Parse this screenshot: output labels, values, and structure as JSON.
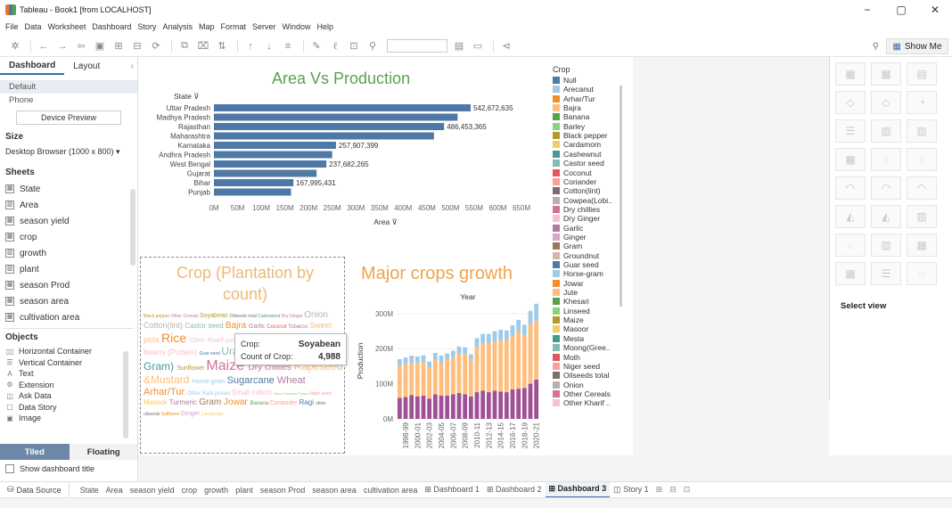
{
  "window": {
    "title": "Tableau - Book1 [from LOCALHOST]",
    "minimize": "−",
    "maximize": "▢",
    "close": "✕"
  },
  "menu": [
    "File",
    "Data",
    "Worksheet",
    "Dashboard",
    "Story",
    "Analysis",
    "Map",
    "Format",
    "Server",
    "Window",
    "Help"
  ],
  "toolbar": {
    "show_me": "Show Me"
  },
  "left_panel": {
    "tabs": [
      "Dashboard",
      "Layout"
    ],
    "devices": [
      "Default",
      "Phone"
    ],
    "device_preview": "Device Preview",
    "size_label": "Size",
    "size_value": "Desktop Browser (1000 x 800) ▾",
    "sheets_label": "Sheets",
    "sheets": [
      "State",
      "Area",
      "season yield",
      "crop",
      "growth",
      "plant",
      "season Prod",
      "season area",
      "cultivation area"
    ],
    "objects_label": "Objects",
    "objects": [
      "Horizontal Container",
      "Vertical Container",
      "Text",
      "Extension",
      "Ask Data",
      "Data Story",
      "Image"
    ],
    "tiled": "Tiled",
    "floating": "Floating",
    "show_title": "Show dashboard title"
  },
  "show_me": {
    "select_view": "Select view"
  },
  "sheet_tabs": {
    "data_source": "Data Source",
    "tabs": [
      "State",
      "Area",
      "season yield",
      "crop",
      "growth",
      "plant",
      "season Prod",
      "season area",
      "cultivation area",
      "Dashboard 1",
      "Dashboard 2",
      "Dashboard 3",
      "Story 1"
    ],
    "active": "Dashboard 3"
  },
  "dashboard": {
    "title1": "Area Vs Production",
    "title2": "Crop (Plantation by count)",
    "title3": "Major crops  growth",
    "legend_title": "Crop",
    "legend": [
      {
        "name": "Null",
        "color": "#4e79a7"
      },
      {
        "name": "Arecanut",
        "color": "#a0cbe8"
      },
      {
        "name": "Arhar/Tur",
        "color": "#f28e2b"
      },
      {
        "name": "Bajra",
        "color": "#ffbe7d"
      },
      {
        "name": "Banana",
        "color": "#59a14f"
      },
      {
        "name": "Barley",
        "color": "#8cd17d"
      },
      {
        "name": "Black pepper",
        "color": "#b6992d"
      },
      {
        "name": "Cardamom",
        "color": "#f1ce63"
      },
      {
        "name": "Cashewnut",
        "color": "#499894"
      },
      {
        "name": "Castor seed",
        "color": "#86bcb6"
      },
      {
        "name": "Coconut",
        "color": "#e15759"
      },
      {
        "name": "Coriander",
        "color": "#ff9d9a"
      },
      {
        "name": "Cotton(lint)",
        "color": "#79706e"
      },
      {
        "name": "Cowpea(Lobi..",
        "color": "#bab0ac"
      },
      {
        "name": "Dry chillies",
        "color": "#d37295"
      },
      {
        "name": "Dry Ginger",
        "color": "#fabfd2"
      },
      {
        "name": "Garlic",
        "color": "#b07aa1"
      },
      {
        "name": "Ginger",
        "color": "#d4a6c8"
      },
      {
        "name": "Gram",
        "color": "#9d7660"
      },
      {
        "name": "Groundnut",
        "color": "#d7b5a6"
      },
      {
        "name": "Guar seed",
        "color": "#4e79a7"
      },
      {
        "name": "Horse-gram",
        "color": "#a0cbe8"
      },
      {
        "name": "Jowar",
        "color": "#f28e2b"
      },
      {
        "name": "Jute",
        "color": "#ffbe7d"
      },
      {
        "name": "Khesari",
        "color": "#59a14f"
      },
      {
        "name": "Linseed",
        "color": "#8cd17d"
      },
      {
        "name": "Maize",
        "color": "#b6992d"
      },
      {
        "name": "Masoor",
        "color": "#f1ce63"
      },
      {
        "name": "Mesta",
        "color": "#499894"
      },
      {
        "name": "Moong(Gree..",
        "color": "#86bcb6"
      },
      {
        "name": "Moth",
        "color": "#e15759"
      },
      {
        "name": "Niger seed",
        "color": "#ff9d9a"
      },
      {
        "name": "Oilseeds total",
        "color": "#79706e"
      },
      {
        "name": "Onion",
        "color": "#bab0ac"
      },
      {
        "name": "Other Cereals",
        "color": "#d37295"
      },
      {
        "name": "Other Kharif ..",
        "color": "#fabfd2"
      }
    ],
    "wordcloud": [
      {
        "t": "Black pepper",
        "c": "#b6992d",
        "s": 5
      },
      {
        "t": "Other Cereals",
        "c": "#d37295",
        "s": 5
      },
      {
        "t": "Soyabean",
        "c": "#b6992d",
        "s": 7
      },
      {
        "t": "Oilseeds total",
        "c": "#79706e",
        "s": 5
      },
      {
        "t": "Cashewnut",
        "c": "#499894",
        "s": 5
      },
      {
        "t": "Dry Ginger",
        "c": "#d37295",
        "s": 5
      },
      {
        "t": "Onion",
        "c": "#bab0ac",
        "s": 10
      },
      {
        "t": "Cotton(lint)",
        "c": "#bab0ac",
        "s": 9
      },
      {
        "t": "Castor seed",
        "c": "#86bcb6",
        "s": 8
      },
      {
        "t": "Bajra",
        "c": "#f28e2b",
        "s": 10
      },
      {
        "t": "Garlic",
        "c": "#b07aa1",
        "s": 7
      },
      {
        "t": "Coconut",
        "c": "#e15759",
        "s": 6
      },
      {
        "t": "Tobacco",
        "c": "#b07aa1",
        "s": 6
      },
      {
        "t": "Sweet pota",
        "c": "#ffbe7d",
        "s": 9
      },
      {
        "t": "Rice",
        "c": "#f28e2b",
        "s": 14
      },
      {
        "t": "Other Kharif pulses",
        "c": "#fabfd2",
        "s": 7
      },
      {
        "t": "Groundnut",
        "c": "#59a14f",
        "s": 12
      },
      {
        "t": "Peas & beans (Pulses)",
        "c": "#fabfd2",
        "s": 9
      },
      {
        "t": "Guar seed",
        "c": "#4e79a7",
        "s": 5
      },
      {
        "t": "Urad",
        "c": "#86bcb6",
        "s": 12
      },
      {
        "t": "Moong(Green Gram)",
        "c": "#499894",
        "s": 12
      },
      {
        "t": "Sunflower",
        "c": "#b6992d",
        "s": 7
      },
      {
        "t": "Maize",
        "c": "#d37295",
        "s": 16
      },
      {
        "t": "Dry chillies",
        "c": "#d37295",
        "s": 10
      },
      {
        "t": "Rapeseed &Mustard",
        "c": "#ffbe7d",
        "s": 12
      },
      {
        "t": "Horse-gram",
        "c": "#a0cbe8",
        "s": 7
      },
      {
        "t": "Sugarcane",
        "c": "#4e79a7",
        "s": 11
      },
      {
        "t": "Wheat",
        "c": "#b07aa1",
        "s": 11
      },
      {
        "t": "Arhar/Tur",
        "c": "#f28e2b",
        "s": 11
      },
      {
        "t": "Other Rabi pulses",
        "c": "#a0cbe8",
        "s": 6
      },
      {
        "t": "Small millets",
        "c": "#fabfd2",
        "s": 8
      },
      {
        "t": "Other Summer Pulses",
        "c": "#8cd17d",
        "s": 4
      },
      {
        "t": "Niger seed",
        "c": "#ff9d9a",
        "s": 5
      },
      {
        "t": "Masoor",
        "c": "#f1ce63",
        "s": 8
      },
      {
        "t": "Turmeric",
        "c": "#b07aa1",
        "s": 8
      },
      {
        "t": "Gram",
        "c": "#9d7660",
        "s": 10
      },
      {
        "t": "Jowar",
        "c": "#f28e2b",
        "s": 10
      },
      {
        "t": "Banana",
        "c": "#59a14f",
        "s": 6
      },
      {
        "t": "Coriander",
        "c": "#ff9d9a",
        "s": 7
      },
      {
        "t": "Ragi",
        "c": "#4e79a7",
        "s": 8
      },
      {
        "t": "other oilseeds",
        "c": "#79706e",
        "s": 5
      },
      {
        "t": "Safflower",
        "c": "#f28e2b",
        "s": 5
      },
      {
        "t": "Ginger",
        "c": "#d4a6c8",
        "s": 7
      },
      {
        "t": "Cardamom",
        "c": "#f1ce63",
        "s": 5
      }
    ],
    "tooltip": {
      "crop_label": "Crop:",
      "crop_value": "Soyabean",
      "count_label": "Count of Crop:",
      "count_value": "4,988"
    }
  },
  "chart_data": [
    {
      "type": "bar",
      "orientation": "horizontal",
      "title": "Area Vs Production",
      "ylabel": "State",
      "xlabel": "Area",
      "categories": [
        "Uttar Pradesh",
        "Madhya Pradesh",
        "Rajasthan",
        "Maharashtra",
        "Karnataka",
        "Andhra Pradesh",
        "West Bengal",
        "Gujarat",
        "Bihar",
        "Punjab"
      ],
      "values": [
        542672635,
        515000000,
        486453365,
        465000000,
        257907399,
        250000000,
        237682265,
        217000000,
        167995431,
        163000000
      ],
      "data_labels": {
        "Uttar Pradesh": "542,672,635",
        "Rajasthan": "486,453,365",
        "Karnataka": "257,907,399",
        "West Bengal": "237,682,265",
        "Bihar": "167,995,431"
      },
      "xticks": [
        "0M",
        "50M",
        "100M",
        "150M",
        "200M",
        "250M",
        "300M",
        "350M",
        "400M",
        "450M",
        "500M",
        "550M",
        "600M",
        "650M"
      ],
      "xlim": [
        0,
        650000000
      ],
      "color": "#4e79a7"
    },
    {
      "type": "bar",
      "stacked": true,
      "title": "Major crops  growth",
      "xlabel": "Year",
      "ylabel": "Production",
      "yticks": [
        "0M",
        "100M",
        "200M",
        "300M"
      ],
      "ylim": [
        0,
        330
      ],
      "xticks": [
        "1998-99",
        "2000-01",
        "2002-03",
        "2004-05",
        "2006-07",
        "2008-09",
        "2010-11",
        "2012-13",
        "2014-15",
        "2016-17",
        "2018-19",
        "2020-21"
      ],
      "categories": [
        "1997-98",
        "1998-99",
        "1999-00",
        "2000-01",
        "2001-02",
        "2002-03",
        "2003-04",
        "2004-05",
        "2005-06",
        "2006-07",
        "2007-08",
        "2008-09",
        "2009-10",
        "2010-11",
        "2011-12",
        "2012-13",
        "2013-14",
        "2014-15",
        "2015-16",
        "2016-17",
        "2017-18",
        "2018-19",
        "2019-20",
        "2020-21"
      ],
      "series": [
        {
          "color": "#a05195",
          "values": [
            60,
            62,
            68,
            64,
            66,
            58,
            70,
            66,
            66,
            70,
            74,
            70,
            64,
            76,
            80,
            76,
            80,
            78,
            76,
            84,
            86,
            88,
            100,
            112
          ]
        },
        {
          "color": "#ffbe7d",
          "values": [
            90,
            95,
            92,
            95,
            96,
            88,
            98,
            94,
            102,
            106,
            112,
            114,
            104,
            128,
            134,
            140,
            140,
            148,
            148,
            152,
            162,
            150,
            170,
            168
          ]
        },
        {
          "color": "#a0cbe8",
          "values": [
            20,
            18,
            20,
            19,
            19,
            17,
            20,
            20,
            18,
            18,
            20,
            20,
            16,
            26,
            28,
            26,
            30,
            28,
            28,
            30,
            34,
            30,
            38,
            48
          ]
        }
      ]
    }
  ]
}
